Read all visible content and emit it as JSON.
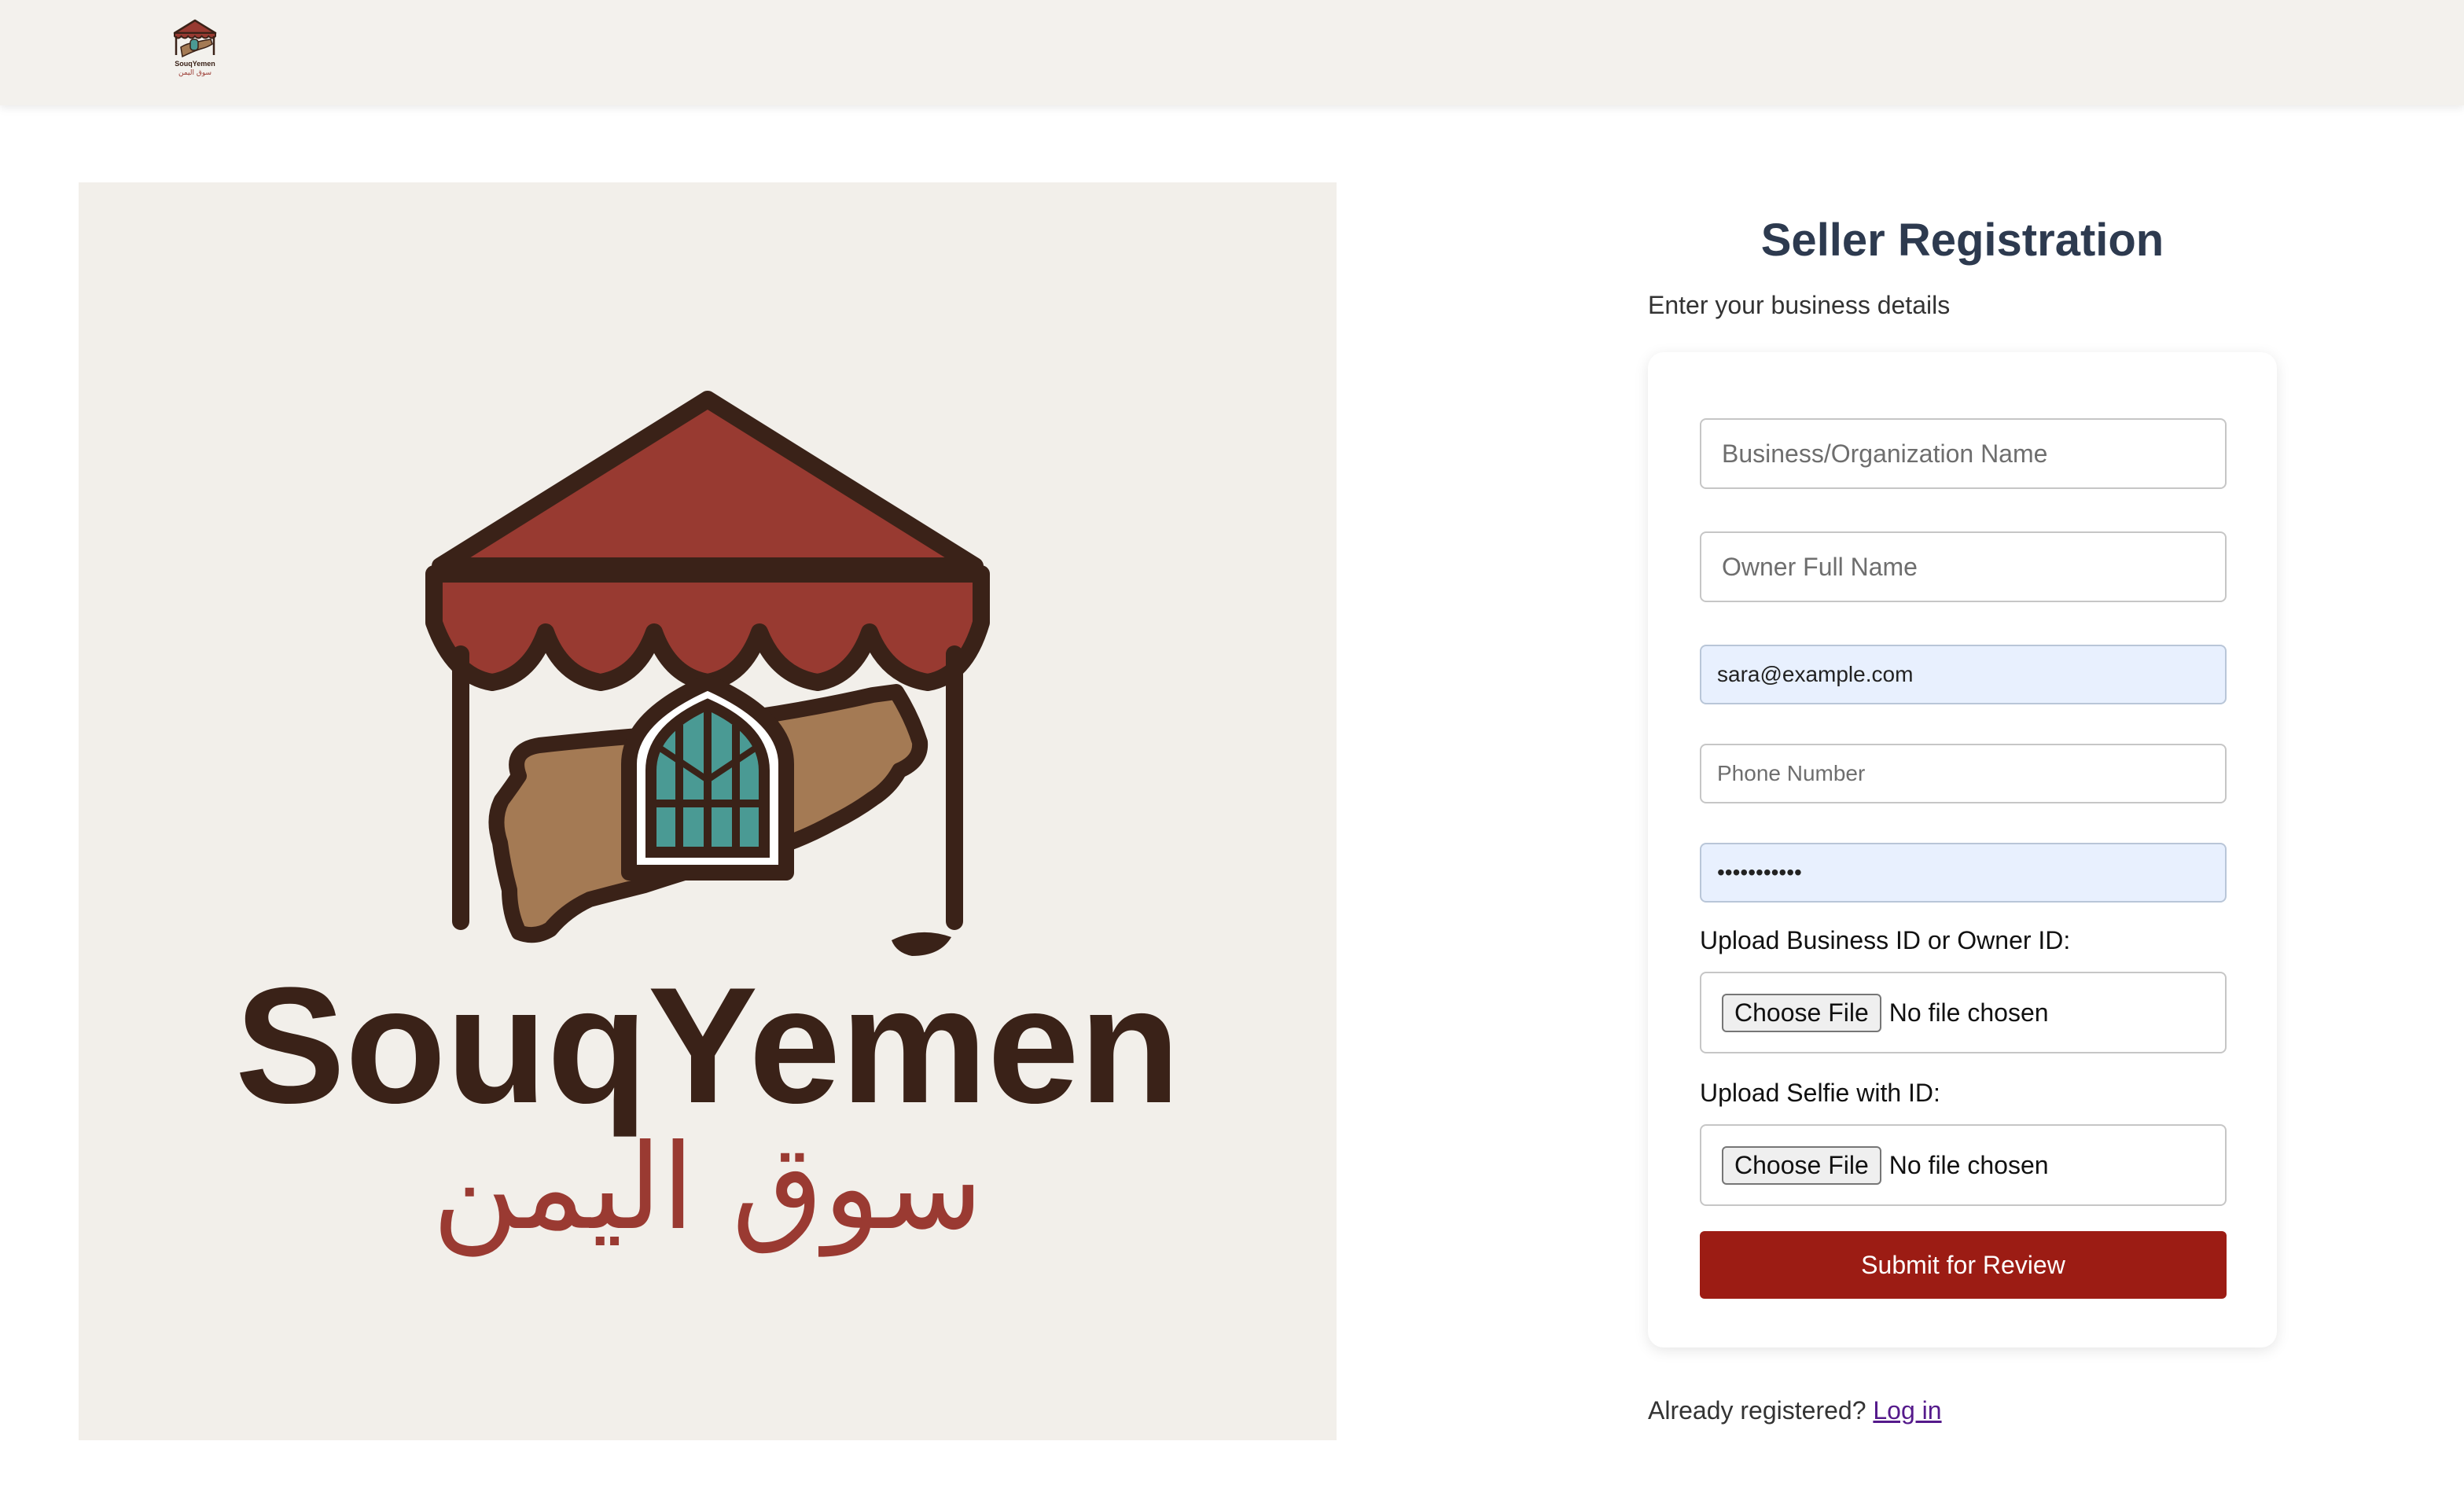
{
  "header": {
    "logo": {
      "name": "SouqYemen",
      "arabic_name": "سوق اليمن"
    }
  },
  "hero": {
    "brand_name": "SouqYemen",
    "brand_arabic": "سوق اليمن",
    "colors": {
      "awning": "#983a31",
      "outline": "#3a2218",
      "map": "#a47a54",
      "window": "#4a9a94",
      "arabic_text": "#9a3a32"
    }
  },
  "form": {
    "title": "Seller Registration",
    "subtitle": "Enter your business details",
    "fields": {
      "business_name": {
        "placeholder": "Business/Organization Name",
        "value": ""
      },
      "owner_name": {
        "placeholder": "Owner Full Name",
        "value": ""
      },
      "email": {
        "value": "sara@example.com"
      },
      "phone": {
        "placeholder": "Phone Number",
        "value": ""
      },
      "password": {
        "value": "•••••••••••"
      }
    },
    "uploads": [
      {
        "label": "Upload Business ID or Owner ID:",
        "button": "Choose File",
        "status": "No file chosen"
      },
      {
        "label": "Upload Selfie with ID:",
        "button": "Choose File",
        "status": "No file chosen"
      }
    ],
    "submit_label": "Submit for Review",
    "login_prompt": "Already registered?",
    "login_link": "Log in"
  },
  "colors": {
    "accent": "#9c1c14",
    "title": "#2d3a4f",
    "topbar_bg": "#f3f1ed"
  }
}
